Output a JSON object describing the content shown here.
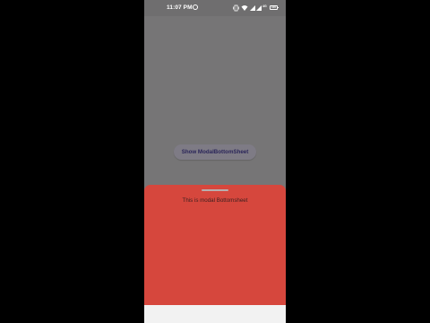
{
  "status_bar": {
    "time": "11:07 PM",
    "network_label": "4G",
    "battery_level": "100",
    "icons": [
      "notification-icon",
      "vibrate-icon",
      "wifi-icon",
      "signal-icon",
      "signal-icon",
      "battery-icon"
    ]
  },
  "main": {
    "button_label": "Show ModalBottomSheet"
  },
  "bottom_sheet": {
    "text": "This is modal Bottomsheet",
    "background_color": "#d6473d"
  },
  "colors": {
    "scrim": "#767576",
    "button_text": "#2a2559"
  }
}
